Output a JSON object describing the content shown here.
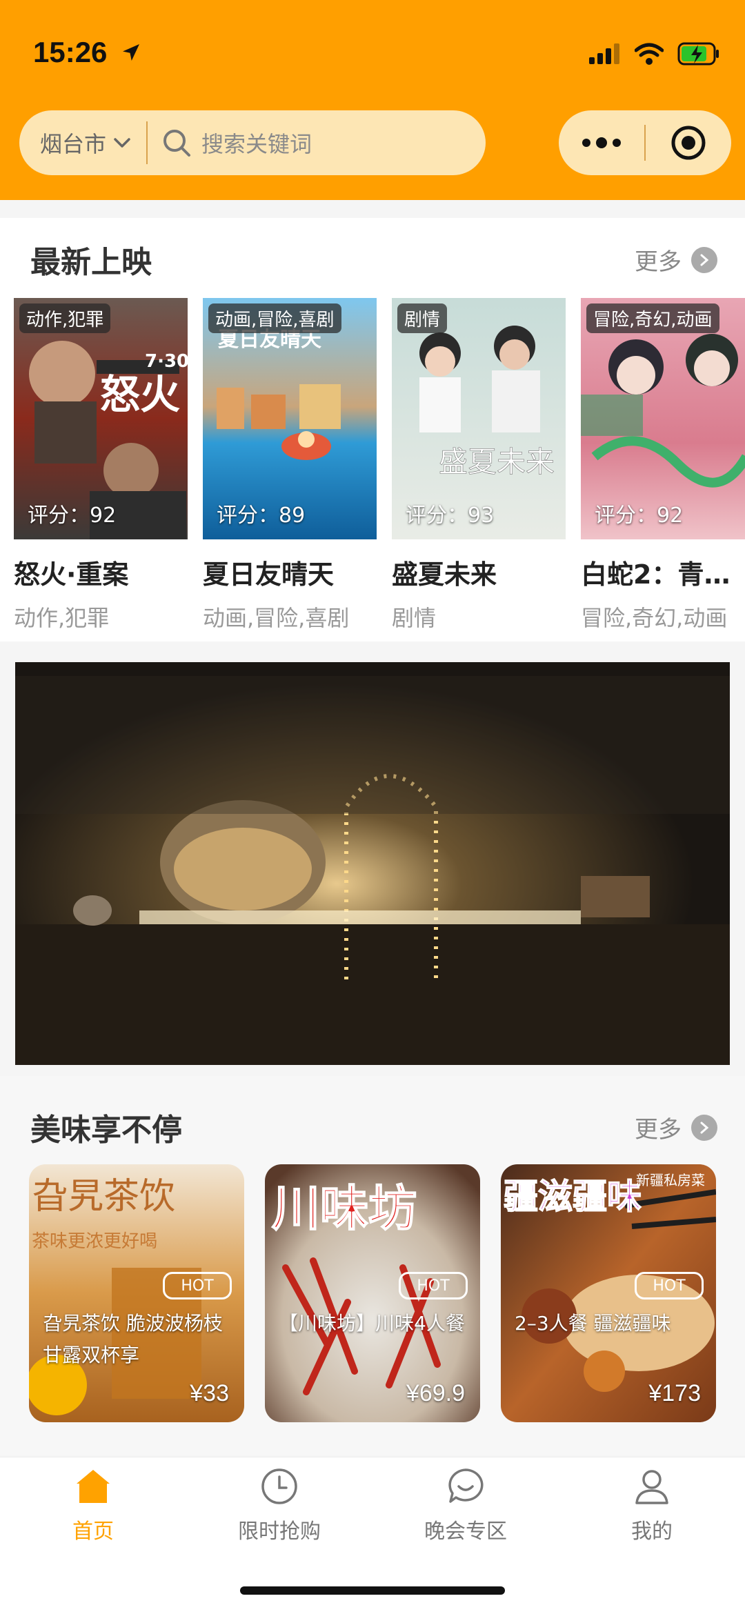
{
  "status_bar": {
    "time": "15:26"
  },
  "header": {
    "city": "烟台市",
    "search_placeholder": "搜索关键词",
    "accent_color": "#ff9f00"
  },
  "movies": {
    "title": "最新上映",
    "more_label": "更多",
    "items": [
      {
        "genre_tag": "动作,犯罪",
        "score": "评分：92",
        "name": "怒火·重案",
        "genre": "动作,犯罪"
      },
      {
        "genre_tag": "动画,冒险,喜剧",
        "score": "评分：89",
        "name": "夏日友晴天",
        "genre": "动画,冒险,喜剧"
      },
      {
        "genre_tag": "剧情",
        "score": "评分：93",
        "name": "盛夏未来",
        "genre": "剧情"
      },
      {
        "genre_tag": "冒险,奇幻,动画",
        "score": "评分：92",
        "name": "白蛇2：青…",
        "genre": "冒险,奇幻,动画"
      }
    ]
  },
  "food": {
    "title": "美味享不停",
    "more_label": "更多",
    "items": [
      {
        "badge": "HOT",
        "desc": "旮旯茶饮 脆波波杨枝甘露双杯享",
        "price": "¥33",
        "sign": "旮旯茶饮"
      },
      {
        "badge": "HOT",
        "desc": "【川味坊】川味4人餐",
        "price": "¥69.9",
        "sign": "川味坊"
      },
      {
        "badge": "HOT",
        "desc": "2–3人餐 疆滋疆味",
        "price": "¥173",
        "sign": "疆滋疆味"
      }
    ]
  },
  "tabbar": {
    "items": [
      {
        "label": "首页",
        "icon": "home-icon",
        "active": true
      },
      {
        "label": "限时抢购",
        "icon": "clock-icon",
        "active": false
      },
      {
        "label": "晚会专区",
        "icon": "chat-bubble-icon",
        "active": false
      },
      {
        "label": "我的",
        "icon": "user-icon",
        "active": false
      }
    ]
  }
}
